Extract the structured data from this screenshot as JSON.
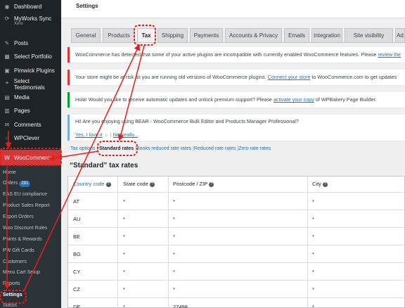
{
  "sidebar": {
    "items": [
      {
        "label": "Dashboard",
        "icon": "dashboard-icon",
        "glyph": "◉"
      },
      {
        "label": "MyWorks Sync",
        "sublabel": "Xero",
        "icon": "sync-icon",
        "glyph": "⟳"
      },
      {
        "label": "Posts",
        "icon": "pin-icon",
        "glyph": "✎"
      },
      {
        "label": "Select Portfolio",
        "icon": "portfolio-icon",
        "glyph": "▦"
      },
      {
        "label": "Pimwick Plugins",
        "icon": "plugin-icon",
        "glyph": "▣"
      },
      {
        "label": "Select Testimonials",
        "icon": "testimonial-icon",
        "glyph": "❝"
      },
      {
        "label": "Media",
        "icon": "media-icon",
        "glyph": "▤"
      },
      {
        "label": "Pages",
        "icon": "pages-icon",
        "glyph": "▥"
      },
      {
        "label": "Comments",
        "icon": "comments-icon",
        "glyph": "✉"
      },
      {
        "label": "WPClever",
        "icon": "wpclever-icon",
        "glyph": "○"
      },
      {
        "label": "WooCommerce",
        "icon": "woocommerce-icon",
        "glyph": "W"
      }
    ],
    "woo_submenu": [
      {
        "label": "Home"
      },
      {
        "label": "Orders",
        "badge": "281"
      },
      {
        "label": "EAS EU compliance"
      },
      {
        "label": "Product Sales Report"
      },
      {
        "label": "Export Orders"
      },
      {
        "label": "Woo Discount Rules"
      },
      {
        "label": "Points & Rewards"
      },
      {
        "label": "PW Gift Cards"
      },
      {
        "label": "Customers"
      },
      {
        "label": "Menu Cart Setup"
      },
      {
        "label": "Reports"
      },
      {
        "label": "Settings"
      },
      {
        "label": "Status"
      }
    ]
  },
  "header": {
    "title": "Settings"
  },
  "tabs": [
    "General",
    "Products",
    "Tax",
    "Shipping",
    "Payments",
    "Accounts & Privacy",
    "Emails",
    "Integration",
    "Site visibility",
    "Ad"
  ],
  "active_tab": "Tax",
  "notices": [
    {
      "text": "WooCommerce has detected that some of your active plugins are incompatible with currently enabled WooCommerce features. Please ",
      "link": "review the"
    },
    {
      "text": "Your store might be at risk as you are running old versions of WooCommerce plugins. ",
      "link": "Connect your store",
      "after": " to WooCommerce.com to get updates"
    },
    {
      "text": "Hola! Would you like to receive automatic updates and unlock premium support? Please ",
      "link": "activate your copy",
      "after": " of WPBakery Page Builder."
    },
    {
      "text": "Hi! Are you enjoying using BEAR - WooCommerce Bulk Editor and Products Manager Professional?",
      "link": "Yes, I love it",
      "emoji": "☺",
      "link2": "Not really..."
    }
  ],
  "subnav": [
    {
      "label": "Tax options"
    },
    {
      "label": "Standard rates"
    },
    {
      "label": "Books reduced rate rates"
    },
    {
      "label": "Reduced rate rates"
    },
    {
      "label": "Zero rate rates"
    }
  ],
  "subnav_current": "Standard rates",
  "rates_title": "“Standard” tax rates",
  "table": {
    "columns": [
      "Country code",
      "State code",
      "Postcode / ZIP",
      "City"
    ],
    "rows": [
      [
        "AT",
        "*",
        "*",
        "*"
      ],
      [
        "AU",
        "*",
        "*",
        "*"
      ],
      [
        "BE",
        "*",
        "*",
        "*"
      ],
      [
        "BG",
        "*",
        "*",
        "*"
      ],
      [
        "CY",
        "*",
        "*",
        "*"
      ],
      [
        "CZ",
        "*",
        "*",
        "*"
      ],
      [
        "DE",
        "*",
        "27498",
        "*"
      ]
    ]
  },
  "colors": {
    "sidebar_bg": "#1d2327",
    "woo_active": "#d63638",
    "link": "#2271b1",
    "annotation": "#e0201b"
  }
}
